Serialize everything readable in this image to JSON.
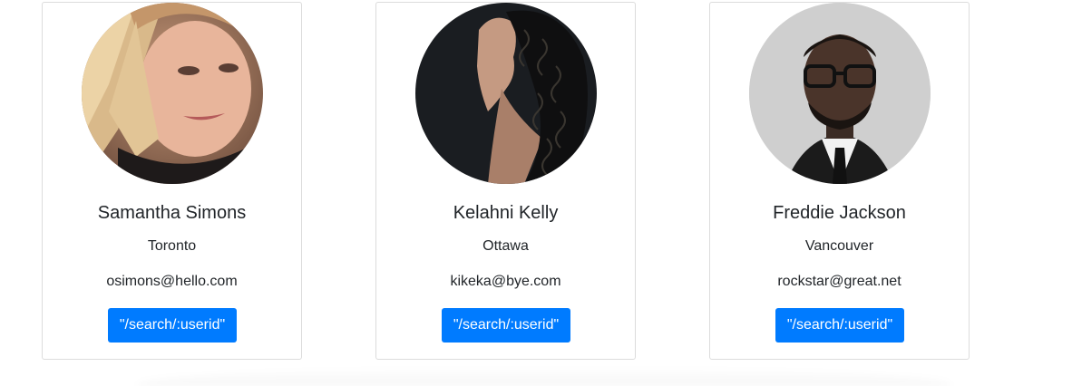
{
  "cards": [
    {
      "name": "Samantha Simons",
      "city": "Toronto",
      "email": "osimons@hello.com",
      "button_label": "\"/search/:userid\"",
      "avatar_icon": "portrait-blonde-woman"
    },
    {
      "name": "Kelahni Kelly",
      "city": "Ottawa",
      "email": "kikeka@bye.com",
      "button_label": "\"/search/:userid\"",
      "avatar_icon": "portrait-curly-hair-woman"
    },
    {
      "name": "Freddie Jackson",
      "city": "Vancouver",
      "email": "rockstar@great.net",
      "button_label": "\"/search/:userid\"",
      "avatar_icon": "portrait-man-glasses-suit"
    }
  ],
  "colors": {
    "button": "#007bff",
    "card_border": "#dcdcdc",
    "text": "#212529"
  }
}
